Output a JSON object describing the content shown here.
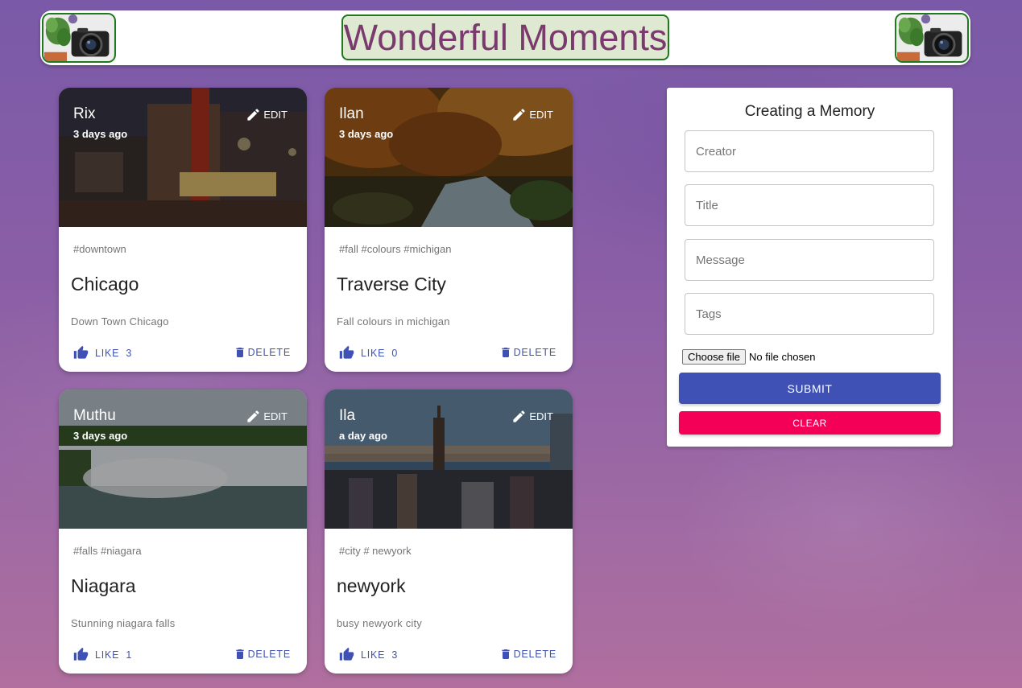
{
  "header": {
    "title": "Wonderful Moments",
    "title_color": "#7a3a6e",
    "logo_icon": "camera-plant-icon"
  },
  "posts": [
    {
      "creator": "Rix",
      "time": "3 days ago",
      "edit_label": "EDIT",
      "tags": "#downtown",
      "title": "Chicago",
      "message": "Down Town Chicago",
      "like_label": "LIKE",
      "like_count": "3",
      "delete_label": "DELETE"
    },
    {
      "creator": "Ilan",
      "time": "3 days ago",
      "edit_label": "EDIT",
      "tags": "#fall #colours #michigan",
      "title": "Traverse City",
      "message": "Fall colours in michigan",
      "like_label": "LIKE",
      "like_count": "0",
      "delete_label": "DELETE"
    },
    {
      "creator": "Muthu",
      "time": "3 days ago",
      "edit_label": "EDIT",
      "tags": "#falls #niagara",
      "title": "Niagara",
      "message": "Stunning niagara falls",
      "like_label": "LIKE",
      "like_count": "1",
      "delete_label": "DELETE"
    },
    {
      "creator": "Ila",
      "time": "a day ago",
      "edit_label": "EDIT",
      "tags": "#city # newyork",
      "title": "newyork",
      "message": "busy newyork city",
      "like_label": "LIKE",
      "like_count": "3",
      "delete_label": "DELETE"
    }
  ],
  "form": {
    "title": "Creating a Memory",
    "creator_placeholder": "Creator",
    "title_placeholder": "Title",
    "message_placeholder": "Message",
    "tags_placeholder": "Tags",
    "file_button": "Choose file",
    "file_status": "No file chosen",
    "submit_label": "SUBMIT",
    "clear_label": "CLEAR"
  },
  "colors": {
    "primary": "#3f51b5",
    "secondary": "#f50057",
    "brand_border": "#1f7a1f"
  },
  "icons": {
    "edit": "pencil-icon",
    "like": "thumb-up-icon",
    "delete": "trash-icon"
  }
}
